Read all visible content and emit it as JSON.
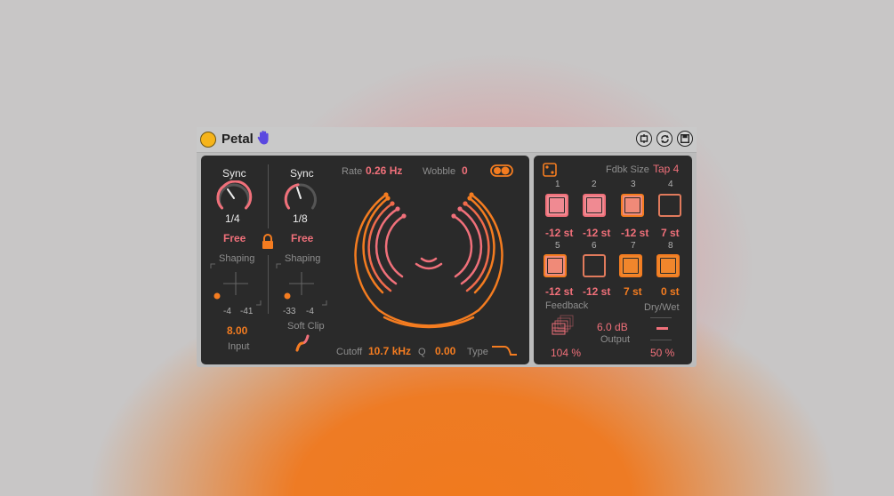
{
  "device": {
    "title": "Petal",
    "icons": {
      "power": "power-icon",
      "hand": "hand-icon",
      "hotswap": "hotswap-icon",
      "refresh": "refresh-icon",
      "save": "save-icon"
    }
  },
  "left": {
    "sync1_label": "Sync",
    "sync1_value": "1/4",
    "sync2_label": "Sync",
    "sync2_value": "1/8",
    "free1": "Free",
    "free2": "Free",
    "shaping1_label": "Shaping",
    "shaping2_label": "Shaping",
    "shaping1_x": "-4",
    "shaping1_y": "-41",
    "shaping2_x": "-33",
    "shaping2_y": "-4",
    "input_value": "8.00",
    "input_label": "Input",
    "softclip_label": "Soft Clip"
  },
  "center": {
    "rate_label": "Rate",
    "rate_value": "0.26 Hz",
    "wobble_label": "Wobble",
    "wobble_value": "0",
    "cutoff_label": "Cutoff",
    "cutoff_value": "10.7 kHz",
    "q_label": "Q",
    "q_value": "0.00",
    "type_label": "Type"
  },
  "right": {
    "fdbk_label": "Fdbk Size",
    "fdbk_value": "Tap 4",
    "taps": [
      {
        "num": "1",
        "value": "-12 st"
      },
      {
        "num": "2",
        "value": "-12 st"
      },
      {
        "num": "3",
        "value": "-12 st"
      },
      {
        "num": "4",
        "value": "7 st"
      },
      {
        "num": "5",
        "value": "-12 st"
      },
      {
        "num": "6",
        "value": "-12 st"
      },
      {
        "num": "7",
        "value": "7 st"
      },
      {
        "num": "8",
        "value": "0 st"
      }
    ],
    "feedback_label": "Feedback",
    "feedback_value": "104 %",
    "output_value": "6.0 dB",
    "output_label": "Output",
    "drywet_label": "Dry/Wet",
    "drywet_value": "50 %"
  },
  "colors": {
    "accent_orange": "#f47c20",
    "accent_pink": "#f0707a",
    "panel": "#2a2a2a"
  }
}
